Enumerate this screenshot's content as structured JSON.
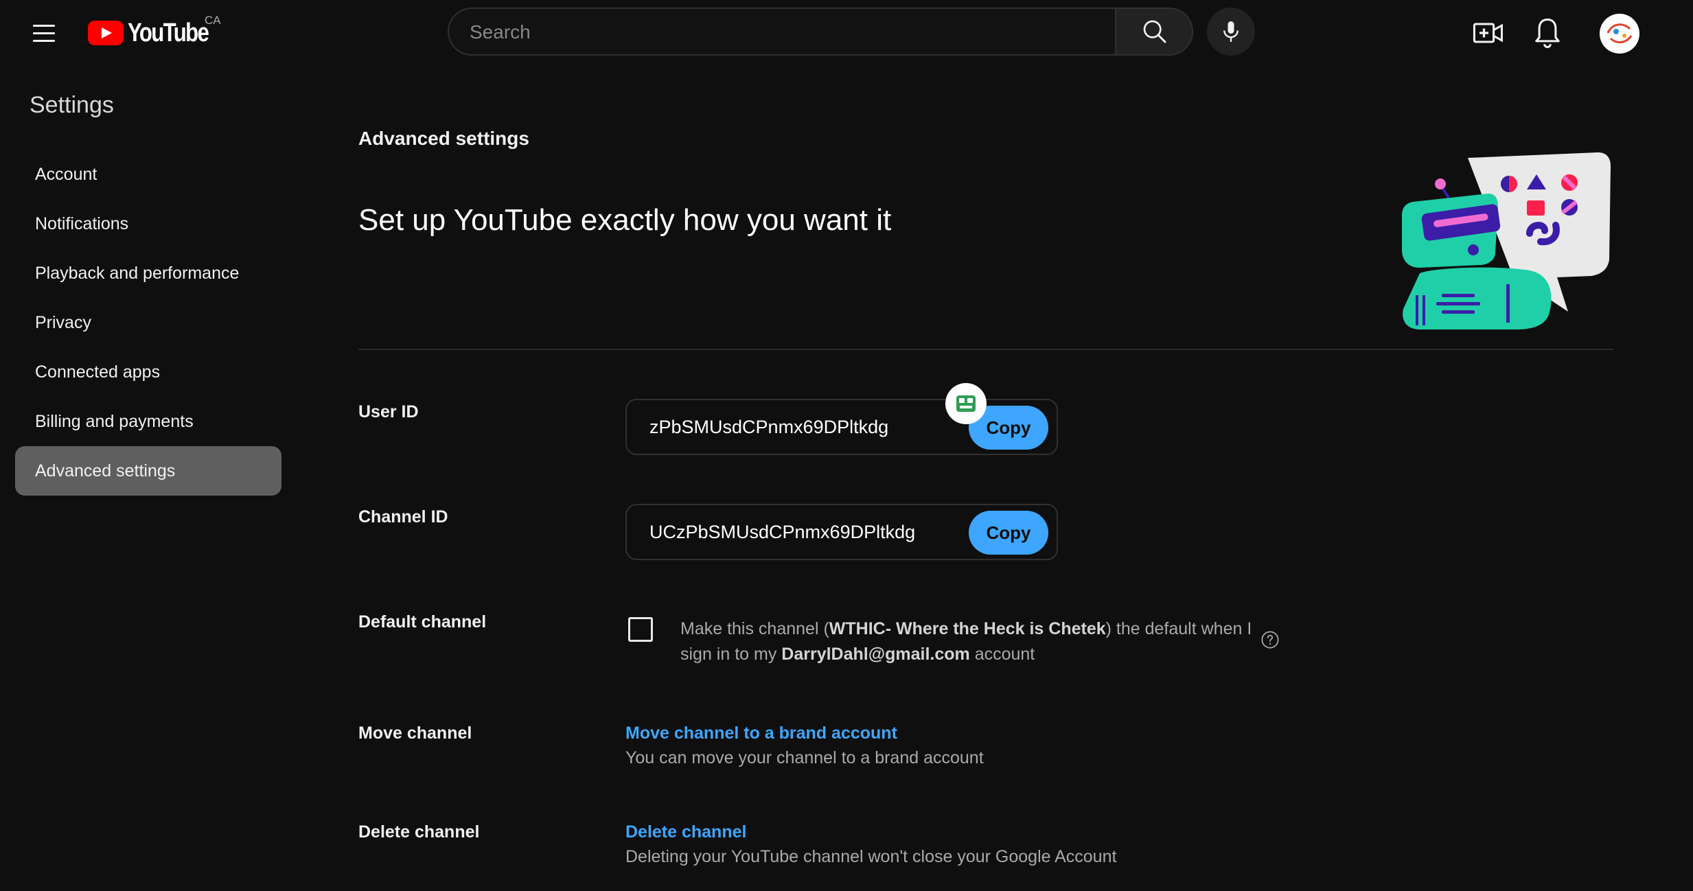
{
  "header": {
    "logo_text": "YouTube",
    "region": "CA",
    "search_placeholder": "Search",
    "accent_color": "#ff0000"
  },
  "sidebar": {
    "title": "Settings",
    "items": [
      {
        "label": "Account",
        "active": false
      },
      {
        "label": "Notifications",
        "active": false
      },
      {
        "label": "Playback and performance",
        "active": false
      },
      {
        "label": "Privacy",
        "active": false
      },
      {
        "label": "Connected apps",
        "active": false
      },
      {
        "label": "Billing and payments",
        "active": false
      },
      {
        "label": "Advanced settings",
        "active": true
      }
    ]
  },
  "main": {
    "heading": "Advanced settings",
    "tagline": "Set up YouTube exactly how you want it",
    "user_id": {
      "label": "User ID",
      "value": "zPbSMUsdCPnmx69DPltkdg",
      "copy_label": "Copy"
    },
    "channel_id": {
      "label": "Channel ID",
      "value": "UCzPbSMUsdCPnmx69DPltkdg",
      "copy_label": "Copy"
    },
    "default_channel": {
      "label": "Default channel",
      "text_1": "Make this channel (",
      "channel_name": "WTHIC- Where the Heck is Chetek",
      "text_2": ") the default when I sign in to my ",
      "email": "DarrylDahl@gmail.com",
      "text_3": " account",
      "checked": false
    },
    "move_channel": {
      "label": "Move channel",
      "link": "Move channel to a brand account",
      "description": "You can move your channel to a brand account"
    },
    "delete_channel": {
      "label": "Delete channel",
      "link": "Delete channel",
      "description": "Deleting your YouTube channel won't close your Google Account"
    },
    "link_color": "#3ea6ff"
  },
  "icons": {
    "menu": "hamburger-menu-icon",
    "search": "search-icon",
    "mic": "microphone-icon",
    "create": "create-video-icon",
    "notifications": "bell-icon",
    "help": "help-circle-icon",
    "extension": "extension-badge-icon"
  }
}
